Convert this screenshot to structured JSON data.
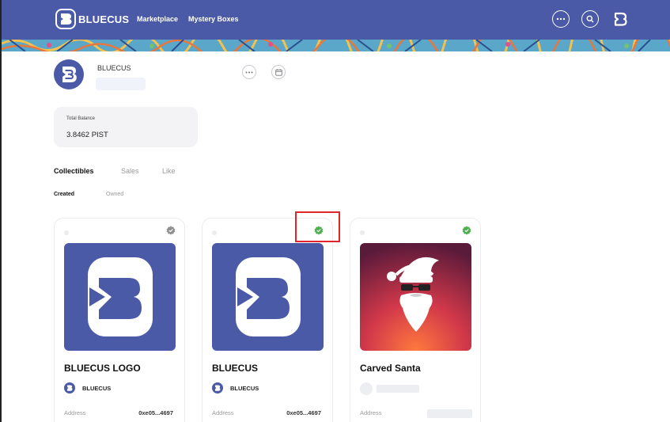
{
  "app": {
    "name": "BLUECUS",
    "brand_color": "#4b5aa6"
  },
  "header": {
    "nav": [
      "Marketplace",
      "Mystery Boxes"
    ],
    "icons": [
      "more-icon",
      "search-icon",
      "profile-logo-icon"
    ]
  },
  "profile": {
    "name": "BLUECUS"
  },
  "balance": {
    "label": "Total Balance",
    "value": "3.8462 PIST"
  },
  "tabs": [
    "Collectibles",
    "Sales",
    "Like"
  ],
  "subtabs": [
    "Created",
    "Owned"
  ],
  "cards": [
    {
      "title": "BLUECUS LOGO",
      "creator": "BLUECUS",
      "address_label": "Address",
      "address": "0xe05...4697",
      "badge": "gear-badge-icon",
      "badge_color": "#8e8e8e"
    },
    {
      "title": "BLUECUS",
      "creator": "BLUECUS",
      "address_label": "Address",
      "address": "0xe05...4697",
      "badge": "verified-badge-icon",
      "badge_color": "#4caf50"
    },
    {
      "title": "Carved Santa",
      "creator": "",
      "address_label": "Address",
      "address": "",
      "badge": "verified-badge-icon",
      "badge_color": "#4caf50"
    }
  ]
}
